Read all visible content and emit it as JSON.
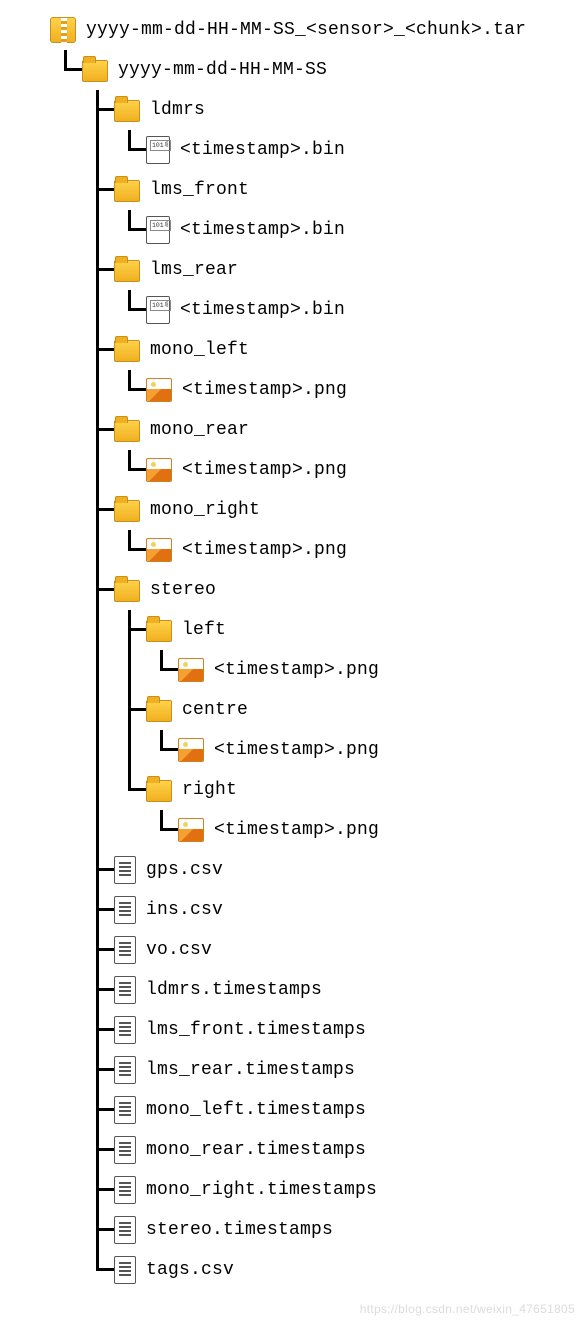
{
  "tree": {
    "root": {
      "type": "archive",
      "label": "yyyy-mm-dd-HH-MM-SS_<sensor>_<chunk>.tar",
      "children": [
        {
          "type": "folder",
          "label": "yyyy-mm-dd-HH-MM-SS",
          "children": [
            {
              "type": "folder",
              "label": "ldmrs",
              "children": [
                {
                  "type": "binfile",
                  "label": "<timestamp>.bin"
                }
              ]
            },
            {
              "type": "folder",
              "label": "lms_front",
              "children": [
                {
                  "type": "binfile",
                  "label": "<timestamp>.bin"
                }
              ]
            },
            {
              "type": "folder",
              "label": "lms_rear",
              "children": [
                {
                  "type": "binfile",
                  "label": "<timestamp>.bin"
                }
              ]
            },
            {
              "type": "folder",
              "label": "mono_left",
              "children": [
                {
                  "type": "imgfile",
                  "label": "<timestamp>.png"
                }
              ]
            },
            {
              "type": "folder",
              "label": "mono_rear",
              "children": [
                {
                  "type": "imgfile",
                  "label": "<timestamp>.png"
                }
              ]
            },
            {
              "type": "folder",
              "label": "mono_right",
              "children": [
                {
                  "type": "imgfile",
                  "label": "<timestamp>.png"
                }
              ]
            },
            {
              "type": "folder",
              "label": "stereo",
              "children": [
                {
                  "type": "folder",
                  "label": "left",
                  "children": [
                    {
                      "type": "imgfile",
                      "label": "<timestamp>.png"
                    }
                  ]
                },
                {
                  "type": "folder",
                  "label": "centre",
                  "children": [
                    {
                      "type": "imgfile",
                      "label": "<timestamp>.png"
                    }
                  ]
                },
                {
                  "type": "folder",
                  "label": "right",
                  "children": [
                    {
                      "type": "imgfile",
                      "label": "<timestamp>.png"
                    }
                  ]
                }
              ]
            },
            {
              "type": "txtfile",
              "label": "gps.csv"
            },
            {
              "type": "txtfile",
              "label": "ins.csv"
            },
            {
              "type": "txtfile",
              "label": "vo.csv"
            },
            {
              "type": "txtfile",
              "label": "ldmrs.timestamps"
            },
            {
              "type": "txtfile",
              "label": "lms_front.timestamps"
            },
            {
              "type": "txtfile",
              "label": "lms_rear.timestamps"
            },
            {
              "type": "txtfile",
              "label": "mono_left.timestamps"
            },
            {
              "type": "txtfile",
              "label": "mono_rear.timestamps"
            },
            {
              "type": "txtfile",
              "label": "mono_right.timestamps"
            },
            {
              "type": "txtfile",
              "label": "stereo.timestamps"
            },
            {
              "type": "txtfile",
              "label": "tags.csv"
            }
          ]
        }
      ]
    }
  },
  "watermark": "https://blog.csdn.net/weixin_47651805"
}
